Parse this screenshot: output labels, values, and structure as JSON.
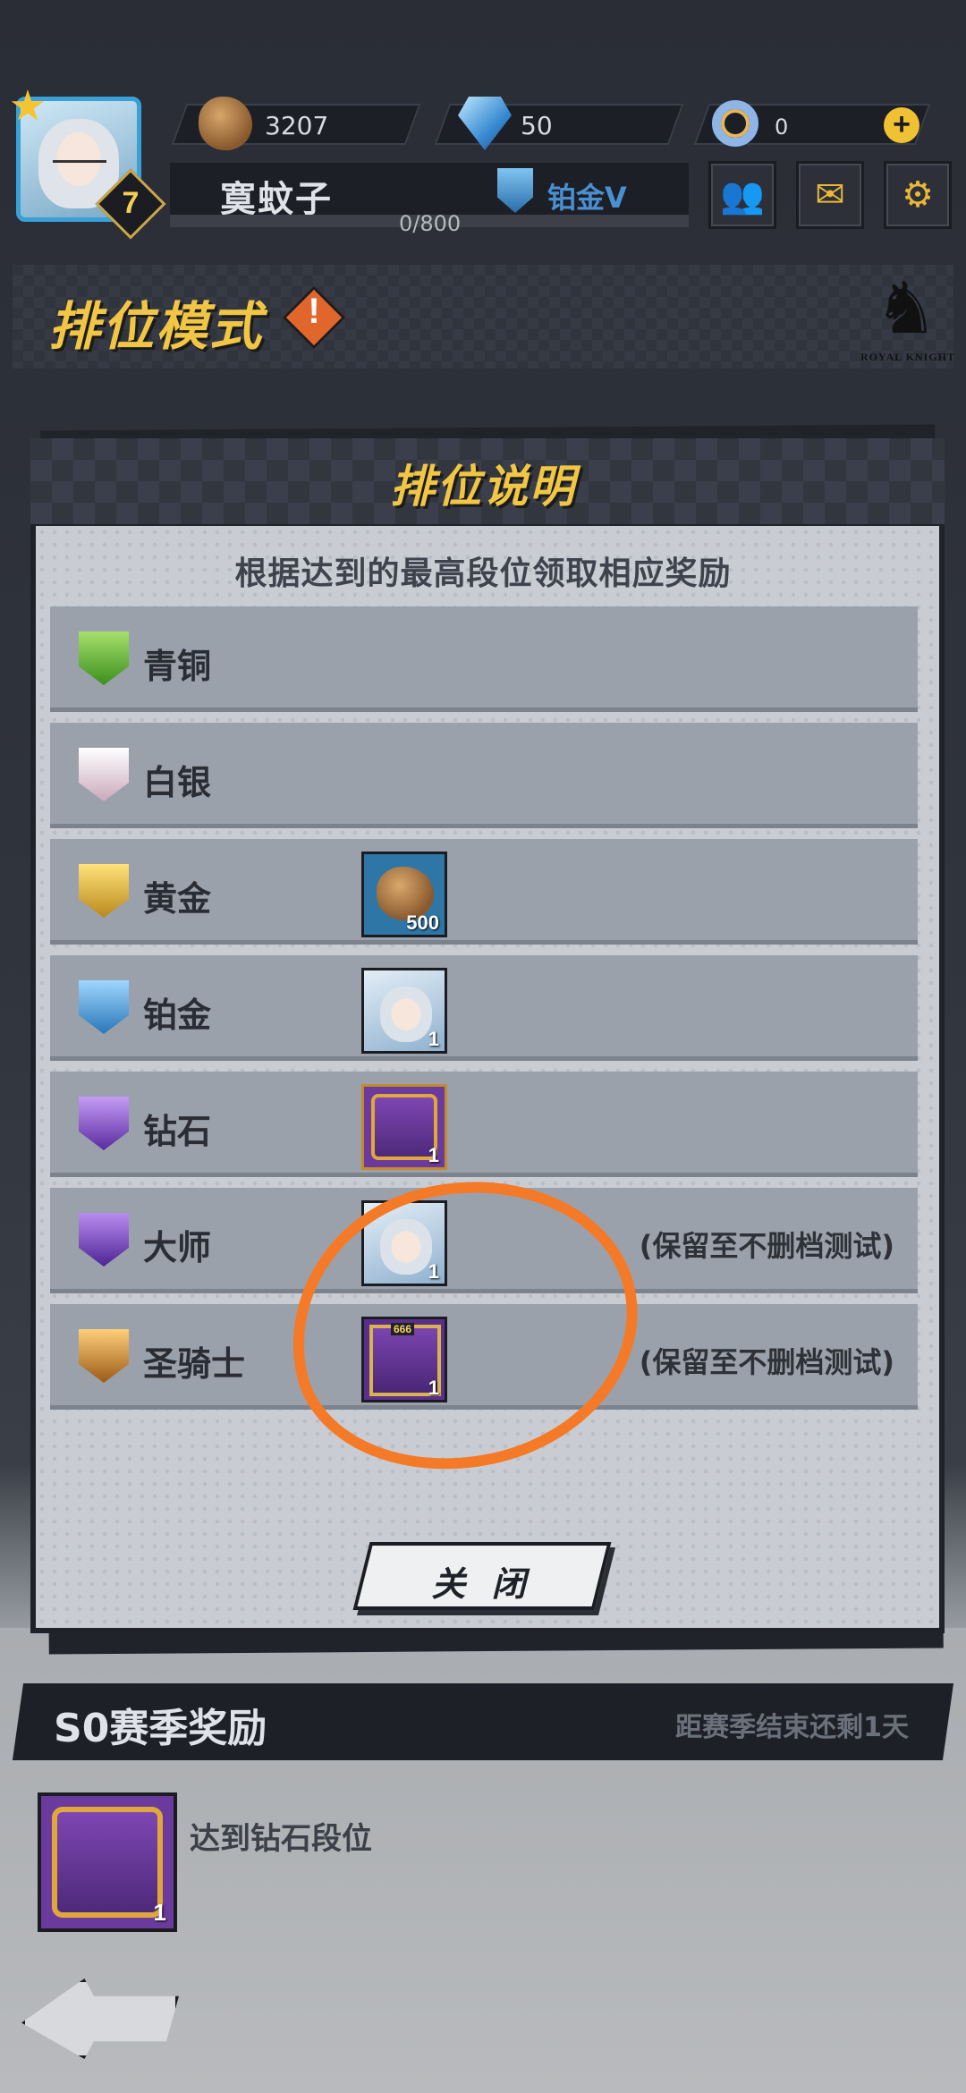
{
  "header": {
    "player_name": "寞蚊子",
    "level": "7",
    "rank": "铂金V",
    "exp": "0/800",
    "resources": [
      {
        "icon": "rock-icon",
        "value": "3207"
      },
      {
        "icon": "gem-icon",
        "value": "50"
      },
      {
        "icon": "ring-icon",
        "value": "0"
      }
    ],
    "add_label": "+",
    "buttons": {
      "friends": "👥",
      "mail": "✉",
      "settings": "⚙"
    }
  },
  "mode": {
    "title": "排位模式",
    "warn_mark": "!",
    "logo_glyph": "♞",
    "logo_text": "ROYAL KNIGHT"
  },
  "dialog": {
    "title": "排位说明",
    "subtitle": "根据达到的最高段位领取相应奖励",
    "tiers": [
      {
        "name": "青铜",
        "color": "#69c23a",
        "note": "",
        "reward": null
      },
      {
        "name": "白银",
        "color": "#e8c9d6",
        "note": "",
        "reward": null
      },
      {
        "name": "黄金",
        "color": "#e9c23a",
        "note": "",
        "reward": {
          "type": "rock",
          "count": "500"
        }
      },
      {
        "name": "铂金",
        "color": "#4aa3e0",
        "note": "",
        "reward": {
          "type": "avatar",
          "count": "1"
        }
      },
      {
        "name": "钻石",
        "color": "#8a4fd0",
        "note": "",
        "reward": {
          "type": "frame",
          "count": "1"
        }
      },
      {
        "name": "大师",
        "color": "#7a4bc9",
        "note": "(保留至不删档测试)",
        "reward": {
          "type": "avatar",
          "count": "1"
        }
      },
      {
        "name": "圣骑士",
        "color": "#d4892a",
        "note": "(保留至不删档测试)",
        "reward": {
          "type": "frame2",
          "count": "1",
          "tag": "666"
        }
      }
    ],
    "close_label": "关 闭"
  },
  "season": {
    "title": "S0赛季奖励",
    "timer": "距赛季结束还剩1天",
    "reward_count": "1",
    "description": "达到钻石段位"
  }
}
